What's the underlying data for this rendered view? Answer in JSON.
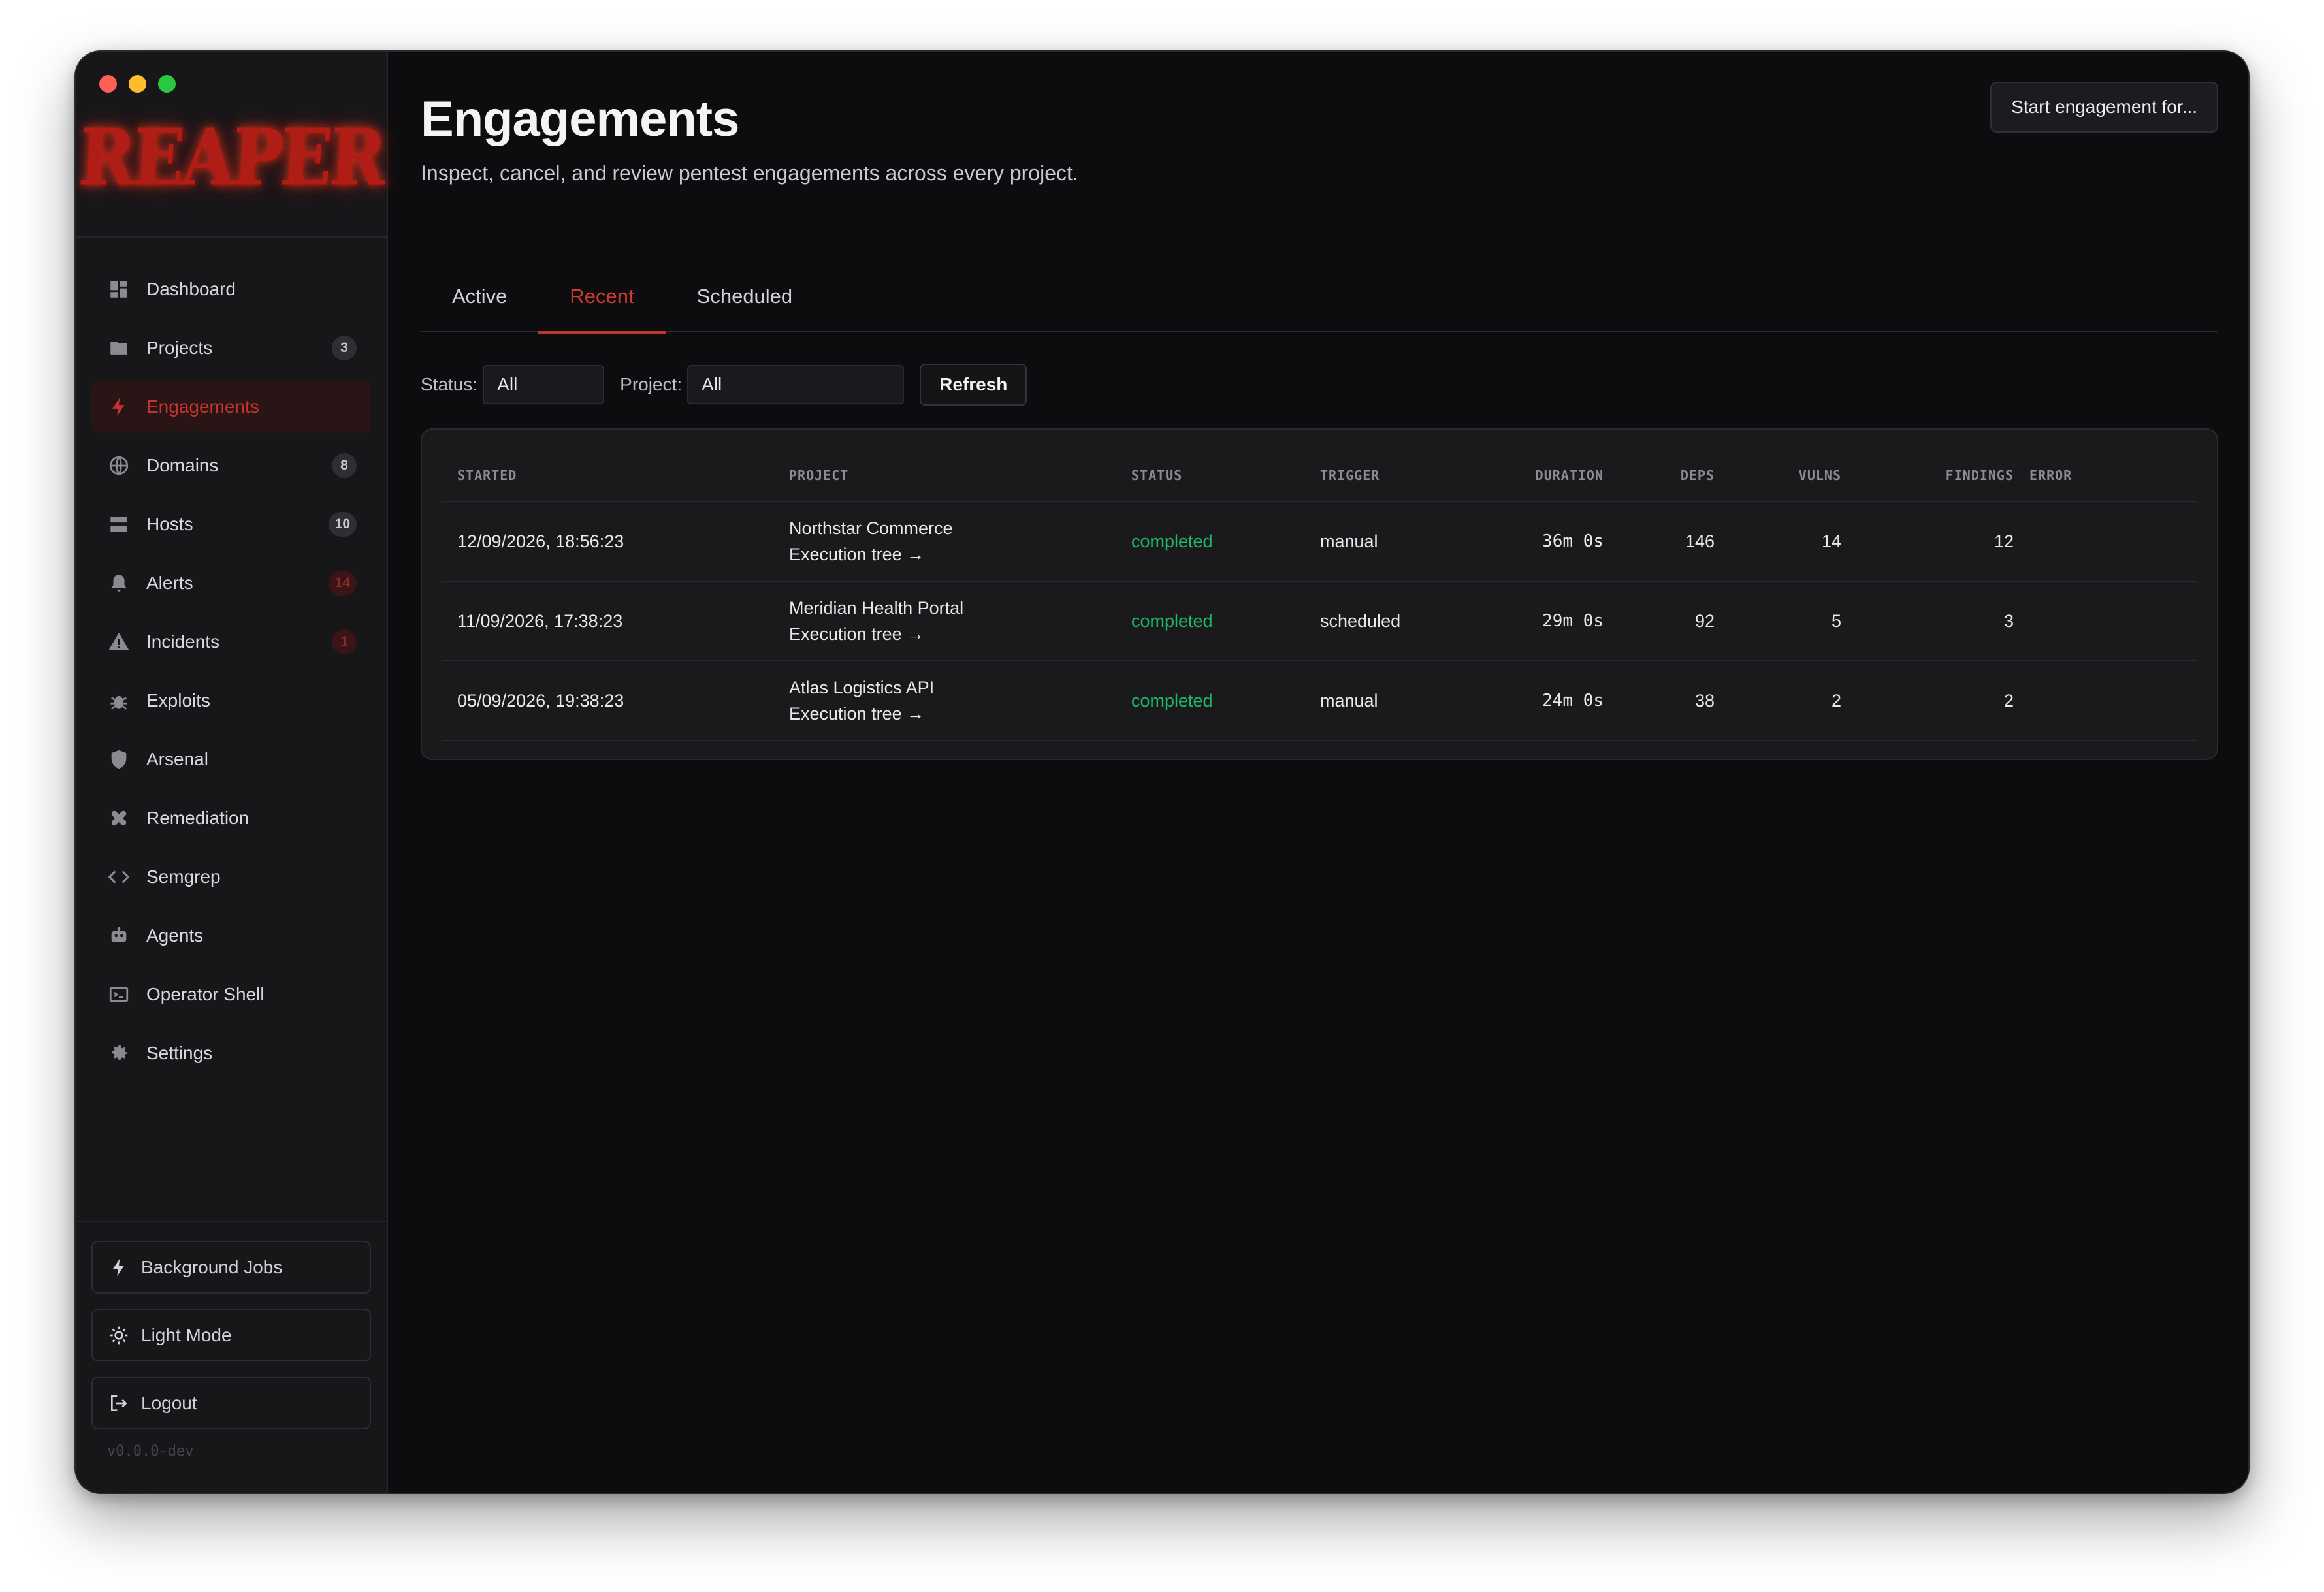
{
  "app": {
    "logo_text": "REAPER",
    "version": "v0.0.0-dev",
    "accent": "#c2342c"
  },
  "sidebar": {
    "items": [
      {
        "label": "Dashboard",
        "icon": "dashboard-icon"
      },
      {
        "label": "Projects",
        "icon": "folder-icon",
        "badge": "3"
      },
      {
        "label": "Engagements",
        "icon": "bolt-icon",
        "active": true
      },
      {
        "label": "Domains",
        "icon": "globe-icon",
        "badge": "8"
      },
      {
        "label": "Hosts",
        "icon": "server-icon",
        "badge": "10"
      },
      {
        "label": "Alerts",
        "icon": "bell-icon",
        "badge": "14"
      },
      {
        "label": "Incidents",
        "icon": "warning-icon",
        "badge": "1"
      },
      {
        "label": "Exploits",
        "icon": "bug-icon"
      },
      {
        "label": "Arsenal",
        "icon": "shield-icon"
      },
      {
        "label": "Remediation",
        "icon": "bandage-icon"
      },
      {
        "label": "Semgrep",
        "icon": "code-icon"
      },
      {
        "label": "Agents",
        "icon": "robot-icon"
      },
      {
        "label": "Operator Shell",
        "icon": "terminal-icon"
      },
      {
        "label": "Settings",
        "icon": "gear-icon"
      }
    ],
    "bottom": {
      "background_jobs": "Background Jobs",
      "light_mode": "Light Mode",
      "logout": "Logout"
    }
  },
  "header": {
    "title": "Engagements",
    "subtitle": "Inspect, cancel, and review pentest engagements across every project.",
    "start_button": "Start engagement for..."
  },
  "tabs": [
    {
      "label": "Active"
    },
    {
      "label": "Recent",
      "active": true
    },
    {
      "label": "Scheduled"
    }
  ],
  "filters": {
    "status_label": "Status:",
    "status_value": "All",
    "project_label": "Project:",
    "project_value": "All",
    "refresh_label": "Refresh"
  },
  "table": {
    "columns": [
      "STARTED",
      "PROJECT",
      "STATUS",
      "TRIGGER",
      "DURATION",
      "DEPS",
      "VULNS",
      "FINDINGS",
      "ERROR"
    ],
    "rows": [
      {
        "started": "12/09/2026, 18:56:23",
        "project": "Northstar Commerce",
        "link": "Execution tree →",
        "status": "completed",
        "trigger": "manual",
        "duration": "36m 0s",
        "deps": "146",
        "vulns": "14",
        "findings": "12",
        "error": ""
      },
      {
        "started": "11/09/2026, 17:38:23",
        "project": "Meridian Health Portal",
        "link": "Execution tree →",
        "status": "completed",
        "trigger": "scheduled",
        "duration": "29m 0s",
        "deps": "92",
        "vulns": "5",
        "findings": "3",
        "error": ""
      },
      {
        "started": "05/09/2026, 19:38:23",
        "project": "Atlas Logistics API",
        "link": "Execution tree →",
        "status": "completed",
        "trigger": "manual",
        "duration": "24m 0s",
        "deps": "38",
        "vulns": "2",
        "findings": "2",
        "error": ""
      }
    ]
  }
}
